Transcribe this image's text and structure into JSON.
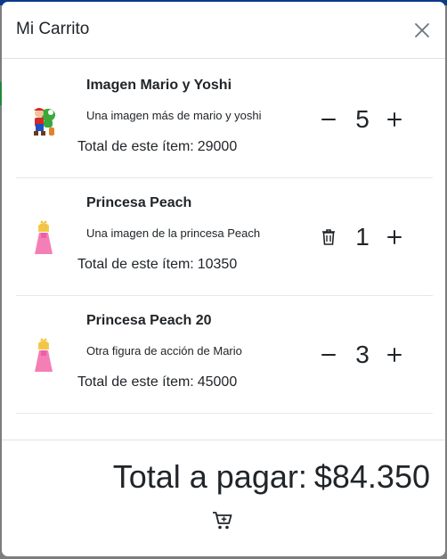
{
  "cart": {
    "title": "Mi Carrito",
    "subtotal_label": "Total de este ítem:",
    "items": [
      {
        "name": "Imagen Mario y Yoshi",
        "description": "Una imagen más de mario y yoshi",
        "subtotal": "29000",
        "quantity": "5",
        "image": "mario-yoshi-thumbnail"
      },
      {
        "name": "Princesa Peach",
        "description": "Una imagen de la princesa Peach",
        "subtotal": "10350",
        "quantity": "1",
        "image": "princess-peach-thumbnail"
      },
      {
        "name": "Princesa Peach 20",
        "description": "Otra figura de acción de Mario",
        "subtotal": "45000",
        "quantity": "3",
        "image": "princess-peach-thumbnail"
      }
    ],
    "total_label": "Total a pagar:",
    "total_value": "$84.350"
  },
  "icons": {
    "close": "close-icon",
    "minus": "minus-icon",
    "plus": "plus-icon",
    "trash": "trash-icon",
    "checkout": "cart-plus-icon"
  }
}
